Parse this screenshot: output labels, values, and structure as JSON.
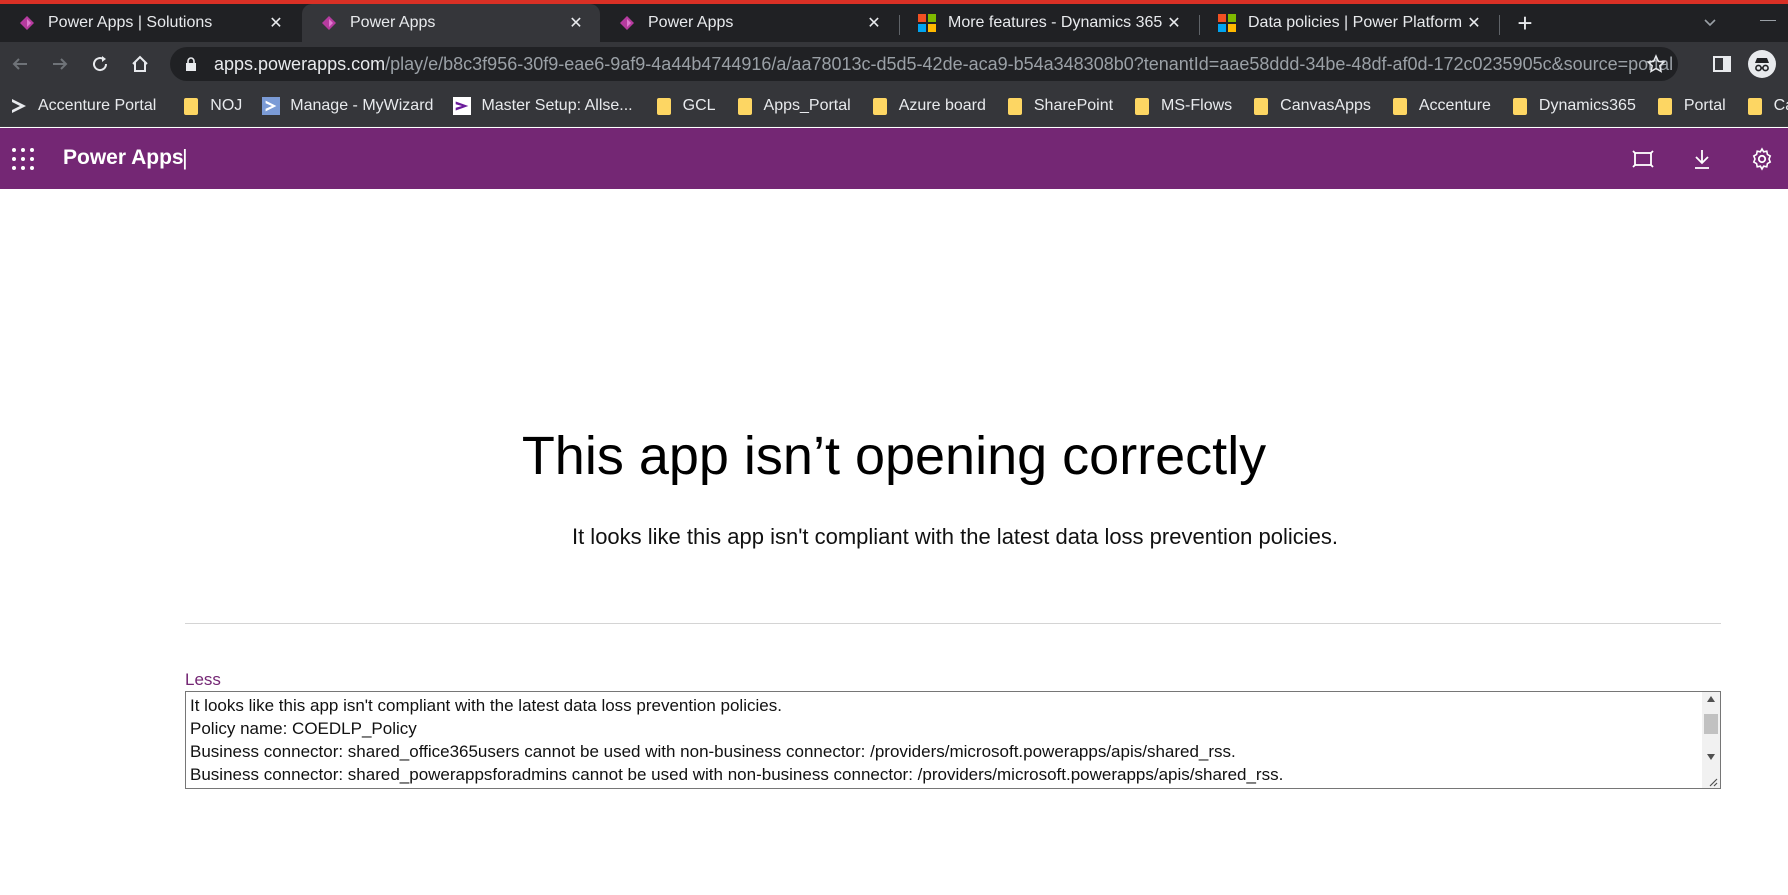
{
  "browser": {
    "tabs": [
      {
        "title": "Power Apps | Solutions",
        "icon": "power-apps-icon"
      },
      {
        "title": "Power Apps",
        "icon": "power-apps-icon",
        "active": true
      },
      {
        "title": "Power Apps",
        "icon": "power-apps-icon"
      },
      {
        "title": "More features - Dynamics 365",
        "icon": "microsoft-logo-icon"
      },
      {
        "title": "Data policies | Power Platform ad",
        "icon": "microsoft-logo-icon"
      }
    ],
    "url_host": "apps.powerapps.com",
    "url_path": "/play/e/b8c3f956-30f9-eae6-9af9-4a44b4744916/a/aa78013c-d5d5-42de-aca9-b54a348308b0?tenantId=aae58ddd-34be-48df-af0d-172c0235905c&source=portal",
    "bookmarks": [
      {
        "label": "Accenture Portal",
        "icon": "accenture-icon"
      },
      {
        "label": "NOJ",
        "icon": "folder-icon"
      },
      {
        "label": "Manage - MyWizard",
        "icon": "mywizard-icon"
      },
      {
        "label": "Master Setup: Allse...",
        "icon": "allsec-icon"
      },
      {
        "label": "GCL",
        "icon": "folder-icon"
      },
      {
        "label": "Apps_Portal",
        "icon": "folder-icon"
      },
      {
        "label": "Azure board",
        "icon": "folder-icon"
      },
      {
        "label": "SharePoint",
        "icon": "folder-icon"
      },
      {
        "label": "MS-Flows",
        "icon": "folder-icon"
      },
      {
        "label": "CanvasApps",
        "icon": "folder-icon"
      },
      {
        "label": "Accenture",
        "icon": "folder-icon"
      },
      {
        "label": "Dynamics365",
        "icon": "folder-icon"
      },
      {
        "label": "Portal",
        "icon": "folder-icon"
      },
      {
        "label": "Carnival",
        "icon": "folder-icon"
      }
    ]
  },
  "app_header": {
    "title": "Power Apps",
    "separator": "|",
    "brand_color": "#742774"
  },
  "error": {
    "heading": "This app isn’t opening correctly",
    "message": "It looks like this app isn't compliant with the latest data loss prevention policies.",
    "toggle_label": "Less",
    "details": [
      "It looks like this app isn't compliant with the latest data loss prevention policies.",
      "Policy name: COEDLP_Policy",
      "Business connector: shared_office365users cannot be used with non-business connector: /providers/microsoft.powerapps/apis/shared_rss.",
      "Business connector: shared_powerappsforadmins cannot be used with non-business connector: /providers/microsoft.powerapps/apis/shared_rss."
    ]
  }
}
